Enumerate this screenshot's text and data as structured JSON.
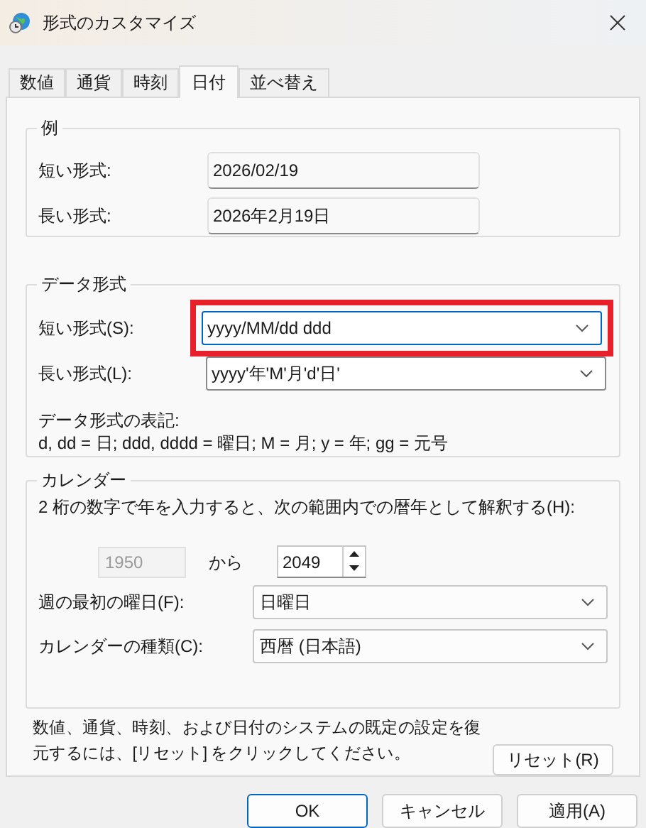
{
  "window": {
    "title": "形式のカスタマイズ"
  },
  "tabs": [
    {
      "label": "数値",
      "selected": false
    },
    {
      "label": "通貨",
      "selected": false
    },
    {
      "label": "時刻",
      "selected": false
    },
    {
      "label": "日付",
      "selected": true
    },
    {
      "label": "並べ替え",
      "selected": false
    }
  ],
  "example": {
    "title": "例",
    "rows": [
      {
        "label": "短い形式:",
        "value": "2026/02/19"
      },
      {
        "label": "長い形式:",
        "value": "2026年2月19日"
      }
    ]
  },
  "date_formats": {
    "title": "データ形式",
    "fields": [
      {
        "label": "短い形式(S):",
        "value": "yyyy/MM/dd ddd",
        "focused": true,
        "highlighted": true
      },
      {
        "label": "長い形式(L):",
        "value": "yyyy'年'M'月'd'日'",
        "focused": false,
        "highlighted": false
      }
    ],
    "notation_title": "データ形式の表記:",
    "notation": "d, dd = 日;  ddd, dddd = 曜日; M = 月; y = 年; gg = 元号"
  },
  "calendar": {
    "title": "カレンダー",
    "two_digit_label": "2 桁の数字で年を入力すると、次の範囲内での暦年として解釈する(H):",
    "from_year": "1950",
    "from_year_disabled": true,
    "to_label": "から",
    "to_year": "2049",
    "fields": [
      {
        "label": "週の最初の曜日(F):",
        "value": "日曜日"
      },
      {
        "label": "カレンダーの種類(C):",
        "value": "西暦 (日本語)"
      }
    ]
  },
  "reset_note": "数値、通貨、時刻、および日付のシステムの既定の設定を復元するには、[リセット] をクリックしてください。",
  "reset_button": "リセット(R)",
  "buttons": [
    {
      "label": "OK",
      "default": true
    },
    {
      "label": "キャンセル",
      "default": false
    },
    {
      "label": "適用(A)",
      "default": false
    }
  ]
}
